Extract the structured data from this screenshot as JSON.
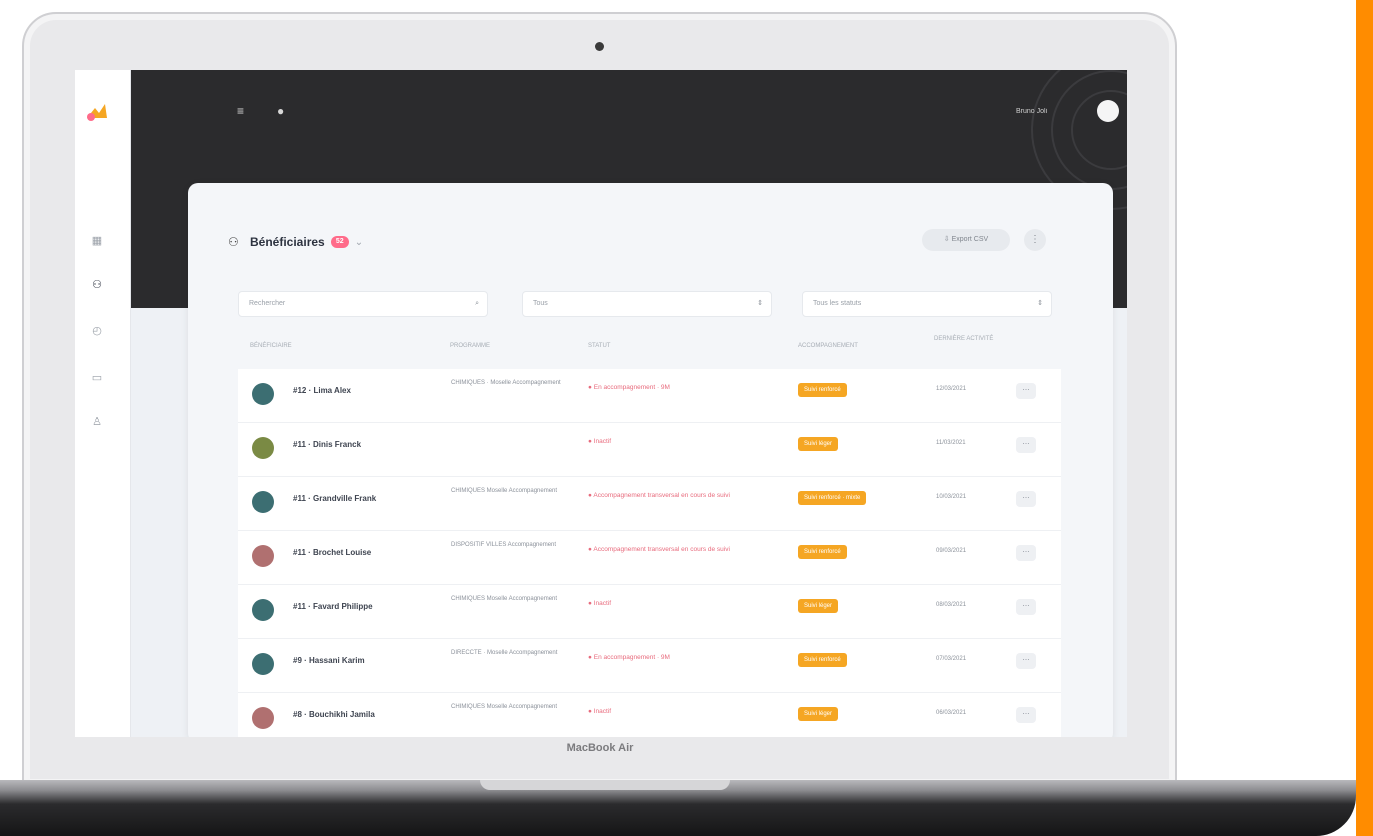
{
  "colors": {
    "accent": "#ff8c00",
    "topbar": "#2b2b2d",
    "pill": "#f5a623",
    "status_text": "#e86b7d",
    "badge": "#ff6b8a"
  },
  "device": {
    "model_label": "MacBook Air"
  },
  "sidebar": {
    "logo_icon": "brand-logo",
    "items": [
      {
        "icon": "grid-icon",
        "glyph": "▦"
      },
      {
        "icon": "users-icon",
        "glyph": "⚇"
      },
      {
        "icon": "clock-icon",
        "glyph": "◴"
      },
      {
        "icon": "message-icon",
        "glyph": "▭"
      },
      {
        "icon": "person-icon",
        "glyph": "♙"
      }
    ]
  },
  "topbar": {
    "menu_icon": "≡",
    "help_icon": "●",
    "user_name": "Bruno Joli"
  },
  "page": {
    "title": "Bénéficiaires",
    "badge": "52",
    "title_caret": "⌄",
    "export_label": "⇩ Export CSV",
    "more_label": "⋮"
  },
  "filters": {
    "search_placeholder": "Rechercher",
    "search_icon": "⌕",
    "program_value": "Tous",
    "status_value": "Tous les statuts",
    "chevron": "⇕"
  },
  "columns": [
    "BÉNÉFICIAIRE",
    "PROGRAMME",
    "STATUT",
    "ACCOMPAGNEMENT",
    "DERNIÈRE ACTIVITÉ"
  ],
  "rows": [
    {
      "name": "#12 · Lima Alex",
      "program": "CHIMIQUES · Moselle Accompagnement",
      "status": "● En accompagnement · 9M",
      "pill": "Suivi renforcé",
      "date": "12/03/2021",
      "avatar": "#3c6e72"
    },
    {
      "name": "#11 · Dinis Franck",
      "program": "",
      "status": "● Inactif",
      "pill": "Suivi léger",
      "date": "11/03/2021",
      "avatar": "#7a8a44"
    },
    {
      "name": "#11 · Grandville Frank",
      "program": "CHIMIQUES Moselle Accompagnement",
      "status": "● Accompagnement transversal en cours de suivi",
      "pill": "Suivi renforcé · mixte",
      "date": "10/03/2021",
      "avatar": "#3c6e72"
    },
    {
      "name": "#11 · Brochet Louise",
      "program": "DISPOSITIF VILLES Accompagnement",
      "status": "● Accompagnement transversal en cours de suivi",
      "pill": "Suivi renforcé",
      "date": "09/03/2021",
      "avatar": "#b07070"
    },
    {
      "name": "#11 · Favard Philippe",
      "program": "CHIMIQUES Moselle Accompagnement",
      "status": "● Inactif",
      "pill": "Suivi léger",
      "date": "08/03/2021",
      "avatar": "#3c6e72"
    },
    {
      "name": "#9 · Hassani Karim",
      "program": "DIRECCTE · Moselle Accompagnement",
      "status": "● En accompagnement · 9M",
      "pill": "Suivi renforcé",
      "date": "07/03/2021",
      "avatar": "#3c6e72"
    },
    {
      "name": "#8 · Bouchikhi Jamila",
      "program": "CHIMIQUES Moselle Accompagnement",
      "status": "● Inactif",
      "pill": "Suivi léger",
      "date": "06/03/2021",
      "avatar": "#b07070"
    }
  ],
  "row_action": "⋯"
}
